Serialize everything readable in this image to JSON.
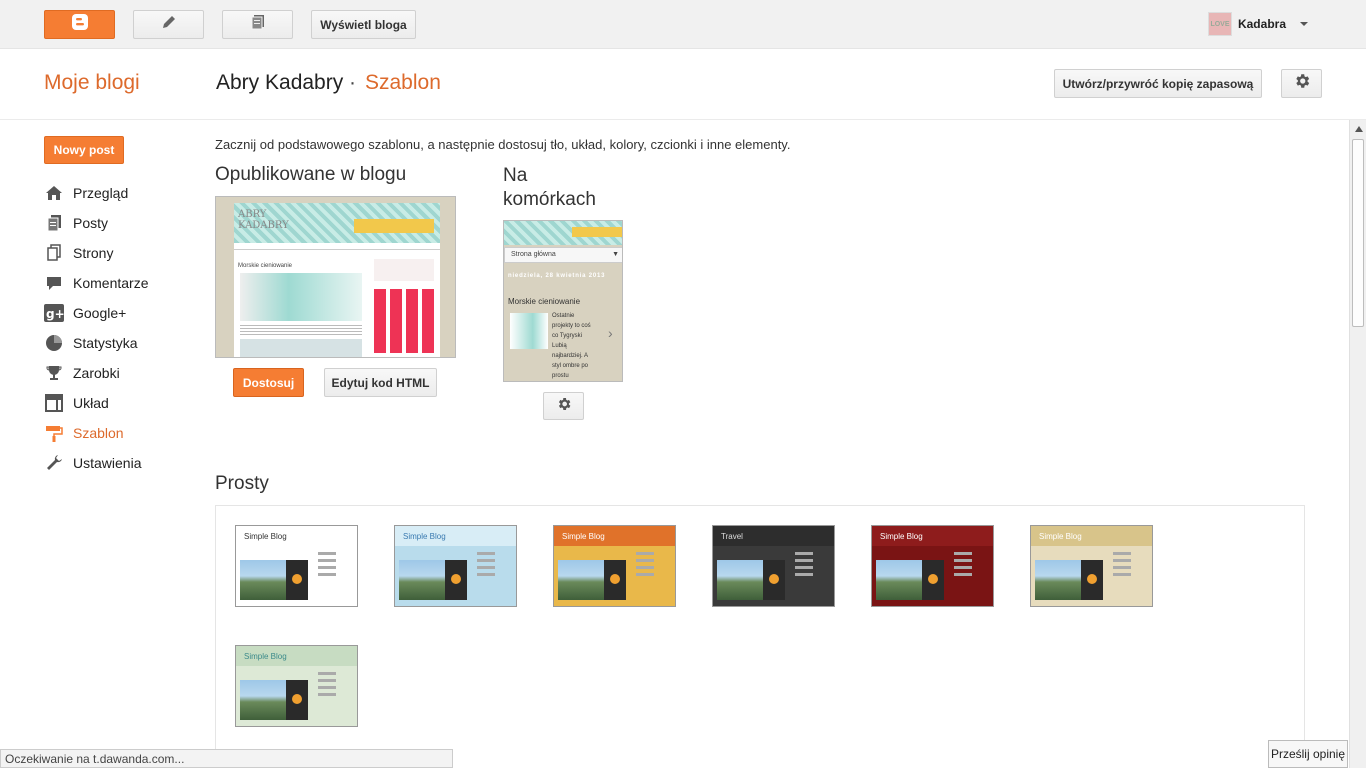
{
  "topbar": {
    "view_blog_label": "Wyświetl bloga",
    "user_name": "Kadabra",
    "avatar_text": "LOVE"
  },
  "header": {
    "my_blogs": "Moje blogi",
    "blog_name": "Abry Kadabry",
    "separator": "·",
    "section": "Szablon",
    "backup_label": "Utwórz/przywróć kopię zapasową"
  },
  "sidebar": {
    "new_post_label": "Nowy post",
    "items": [
      {
        "label": "Przegląd",
        "icon": "home-icon",
        "active": false
      },
      {
        "label": "Posty",
        "icon": "posts-icon",
        "active": false
      },
      {
        "label": "Strony",
        "icon": "pages-icon",
        "active": false
      },
      {
        "label": "Komentarze",
        "icon": "comment-icon",
        "active": false
      },
      {
        "label": "Google+",
        "icon": "google-plus-icon",
        "active": false
      },
      {
        "label": "Statystyka",
        "icon": "pie-chart-icon",
        "active": false
      },
      {
        "label": "Zarobki",
        "icon": "trophy-icon",
        "active": false
      },
      {
        "label": "Układ",
        "icon": "layout-icon",
        "active": false
      },
      {
        "label": "Szablon",
        "icon": "paint-roller-icon",
        "active": true
      },
      {
        "label": "Ustawienia",
        "icon": "wrench-icon",
        "active": false
      }
    ]
  },
  "main": {
    "intro": "Zacznij od podstawowego szablonu, a następnie dostosuj tło, układ, kolory, czcionki i inne elementy.",
    "published_title": "Opublikowane w blogu",
    "mobile_title": "Na komórkach",
    "customize_label": "Dostosuj",
    "edit_html_label": "Edytuj kod HTML",
    "desktop_preview": {
      "header_text": "ABRY KADABRY",
      "post_title": "Morskie cieniowanie"
    },
    "mobile_preview": {
      "dropdown": "Strona główna",
      "date": "niedziela, 28 kwietnia 2013",
      "post_title": "Morskie cieniowanie",
      "excerpt": "Ostatnie projekty to coś co Tygryski Lubią najbardziej. A styl ombre po prostu ubóstwiam! Kocham t..."
    },
    "simple_title": "Prosty",
    "themes": [
      {
        "title": "Simple Blog",
        "header_bg": "#ffffff",
        "bg": "#ffffff",
        "text": "#333333"
      },
      {
        "title": "Simple Blog",
        "header_bg": "#d8edf6",
        "bg": "#b9dcec",
        "text": "#3a7ab0"
      },
      {
        "title": "Simple Blog",
        "header_bg": "#e0722a",
        "bg": "#e9b84a",
        "text": "#ffffff"
      },
      {
        "title": "Travel",
        "header_bg": "#2d2d2d",
        "bg": "#3a3a3a",
        "text": "#dddddd"
      },
      {
        "title": "Simple Blog",
        "header_bg": "#8e1c1c",
        "bg": "#7a1414",
        "text": "#ffffff"
      },
      {
        "title": "Simple Blog",
        "header_bg": "#d8c48a",
        "bg": "#e7dcbd",
        "text": "#ffffff"
      },
      {
        "title": "Simple Blog",
        "header_bg": "#c7dcc2",
        "bg": "#dde9d6",
        "text": "#3b8a8a"
      }
    ]
  },
  "status_text": "Oczekiwanie na t.dawanda.com...",
  "feedback_label": "Prześlij opinię",
  "colors": {
    "accent": "#f57d33",
    "accent_text": "#dd6a2c"
  }
}
